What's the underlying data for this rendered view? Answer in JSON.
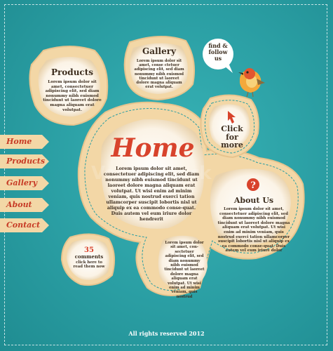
{
  "nav": [
    {
      "label": "Home"
    },
    {
      "label": "Products"
    },
    {
      "label": "Gallery"
    },
    {
      "label": "About"
    },
    {
      "label": "Contact"
    }
  ],
  "products": {
    "title": "Products",
    "body": "Lorem ipsum dolor sit amet, consectetuer adipiscing elit, sed diam nonummy nibh euismod tincidunt ut laoreet dolore magna aliquam erat volutpat."
  },
  "gallery": {
    "title": "Gallery",
    "body": "Lorem ipsum dolor sit amet, conse ctetuer adipiscing elit, sed diam nonummy nibh euismod tincidunt ut laoreet dolore magna aliquam erat volutpat."
  },
  "speech": {
    "text": "find & follow us"
  },
  "click": {
    "text": "Click for more"
  },
  "home": {
    "title": "Home",
    "body": "Lorem ipsum dolor sit amet, consectetuer adipiscing elit, sed diam nonummy nibh euismod tincidunt ut laoreet dolore magna aliquam erat volutpat. Ut wisi enim ad minim veniam, quis nostrud exerci tation ullamcorper suscipit lobortis nisl ut aliquip ex ea commodo conse-quat. Duis autem vel eum iriure dolor hendrerit"
  },
  "about": {
    "title": "About Us",
    "body": "Lorem ipsum dolor sit amet, consectetuer adipiscing elit, sed diam nonummy nibh euismod tincidunt ut laoreet dolore magna aliquam erat volutpat. Ut wisi enim ad minim veniam, quis nostrud exerci tation ullamcorper suscipit lobortis nisl ut aliquip ex ea commodo conse-quat. Duis autem vel eum iriure dolor"
  },
  "comments": {
    "count": "35",
    "label": "comments",
    "hint": "click here to read them now"
  },
  "news": {
    "body": "Lorem ipsum dolor sit amet, con-sectetuer adipiscing elit, sed diam nonummy nibh euismod tincidunt ut laoreet dolore magna aliquam erat volutpat. Ut wisi enim ad minim veniam, quis nostrud"
  },
  "footer": {
    "text": "All rights reserved 2012"
  },
  "watermark": "VectorStock",
  "icons": {
    "help": "help-icon",
    "cursor": "cursor-icon",
    "bird": "bird-icon"
  },
  "colors": {
    "background": "#2a9ea3",
    "panel": "#f4dcae",
    "accent": "#d8432c",
    "text": "#3d2e1f"
  }
}
